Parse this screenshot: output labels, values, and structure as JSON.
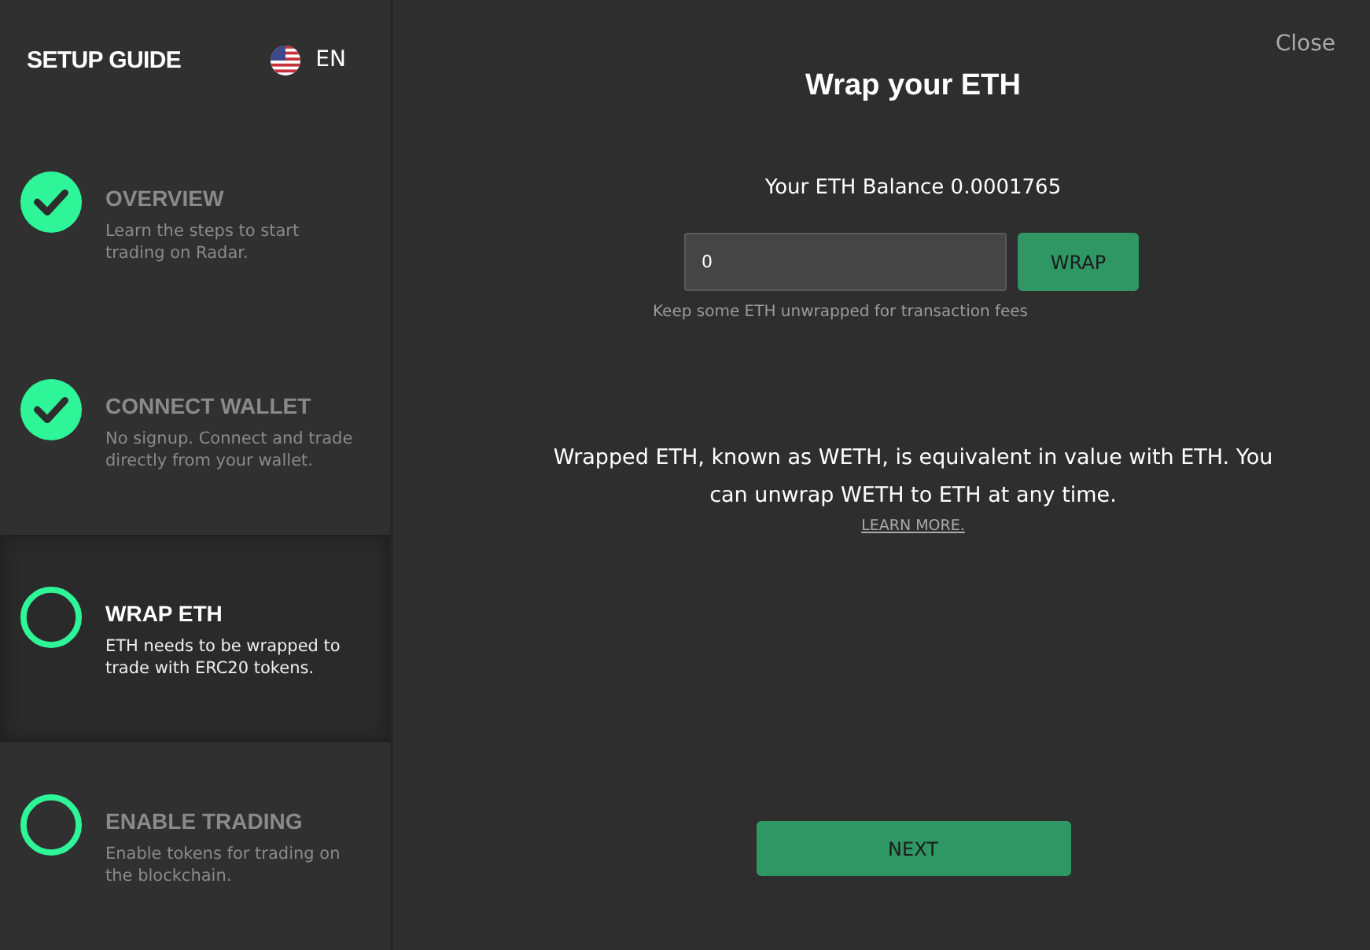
{
  "sidebar": {
    "title": "SETUP GUIDE",
    "language": "EN",
    "steps": [
      {
        "title": "OVERVIEW",
        "description": "Learn the steps to start trading on Radar.",
        "completed": true,
        "selected": false
      },
      {
        "title": "CONNECT WALLET",
        "description": "No signup. Connect and trade directly from your wallet.",
        "completed": true,
        "selected": false
      },
      {
        "title": "WRAP ETH",
        "description": "ETH needs to be wrapped to trade with ERC20 tokens.",
        "completed": false,
        "selected": true
      },
      {
        "title": "ENABLE TRADING",
        "description": "Enable tokens for trading on the blockchain.",
        "completed": false,
        "selected": false
      }
    ]
  },
  "main": {
    "close": "Close",
    "title": "Wrap your ETH",
    "balance": "Your ETH Balance 0.0001765",
    "amount": {
      "value": "0"
    },
    "wrap_button": "WRAP",
    "hint": "Keep some ETH unwrapped for transaction fees",
    "info": "Wrapped ETH, known as WETH, is equivalent in value with ETH. You can unwrap WETH to ETH at any time.",
    "learn_more": "LEARN MORE.",
    "next_button": "NEXT"
  }
}
